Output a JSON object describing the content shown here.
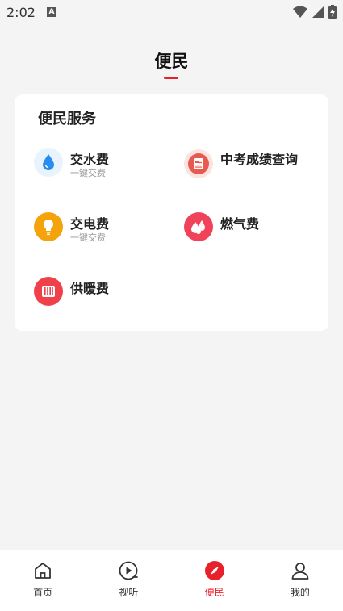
{
  "status_bar": {
    "time": "2:02",
    "notification_icon": "A"
  },
  "header": {
    "title": "便民"
  },
  "card": {
    "title": "便民服务",
    "items": [
      {
        "name": "交水费",
        "subtitle": "一键交费",
        "icon": "water-drop-icon",
        "color": "#2a8cf0"
      },
      {
        "name": "中考成绩查询",
        "subtitle": "",
        "icon": "document-icon",
        "color": "#e85a4f"
      },
      {
        "name": "交电费",
        "subtitle": "一键交费",
        "icon": "lightbulb-icon",
        "color": "#f5a30b"
      },
      {
        "name": "燃气费",
        "subtitle": "",
        "icon": "gas-flame-icon",
        "color": "#f0435a"
      },
      {
        "name": "供暖费",
        "subtitle": "",
        "icon": "radiator-icon",
        "color": "#f0404a"
      }
    ]
  },
  "bottom_nav": {
    "items": [
      {
        "label": "首页",
        "icon": "home-icon"
      },
      {
        "label": "视听",
        "icon": "play-icon"
      },
      {
        "label": "便民",
        "icon": "compass-icon",
        "active": true
      },
      {
        "label": "我的",
        "icon": "user-icon"
      }
    ]
  },
  "colors": {
    "accent": "#e8202a",
    "background": "#f4f4f4"
  }
}
